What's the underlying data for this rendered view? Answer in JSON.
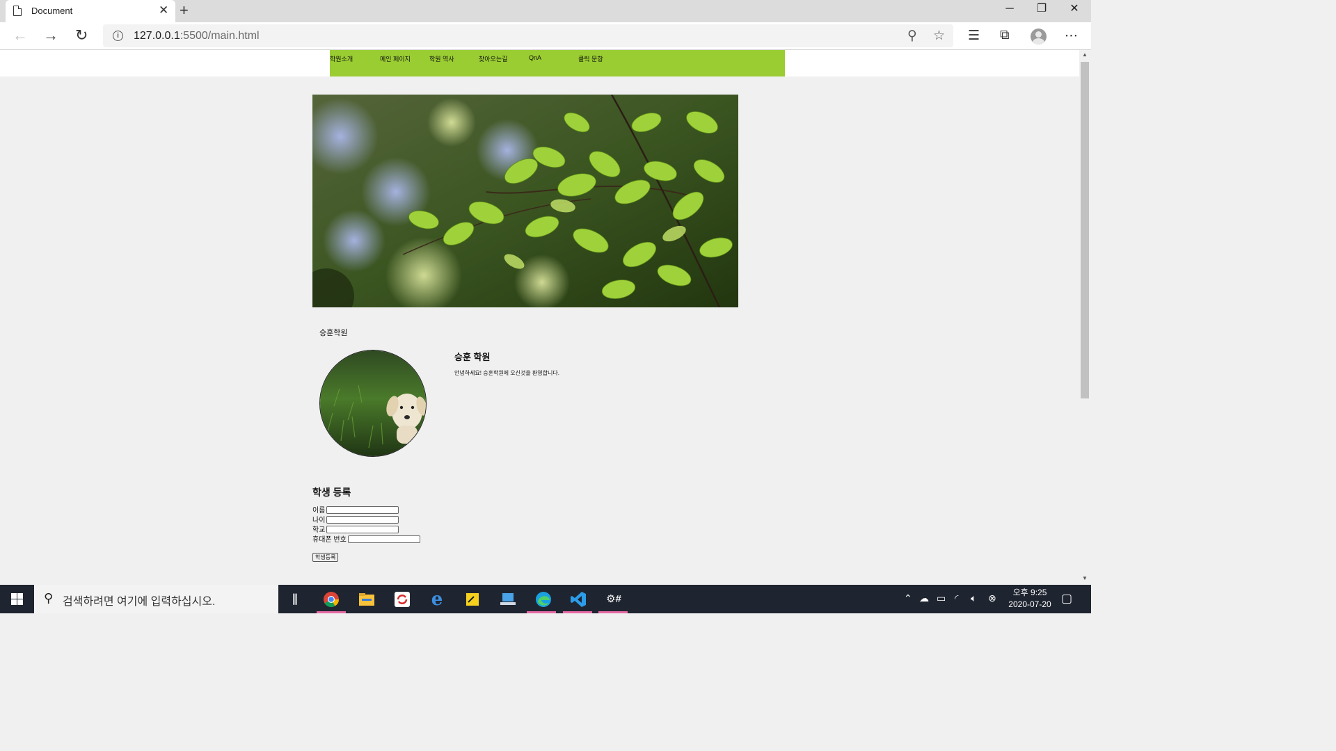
{
  "browser": {
    "tab_title": "Document",
    "tab_close": "✕",
    "new_tab": "+",
    "url_host": "127.0.0.1",
    "url_rest": ":5500/main.html"
  },
  "page": {
    "nav": [
      "학원소개",
      "메인 페이지",
      "학원 역사",
      "찾아오는길",
      "QnA",
      "클릭 문항"
    ],
    "site_name": "승훈학원",
    "intro_title": "승훈 학원",
    "intro_text": "안녕하세요! 승훈학원에 오신것을 환영합니다.",
    "form": {
      "title": "학생 등록",
      "fields": [
        "이름",
        "나이",
        "학교",
        "휴대폰 번호"
      ],
      "submit": "학생등록"
    }
  },
  "taskbar": {
    "search_placeholder": "검색하려면 여기에 입력하십시오.",
    "time": "오후 9:25",
    "date": "2020-07-20"
  }
}
